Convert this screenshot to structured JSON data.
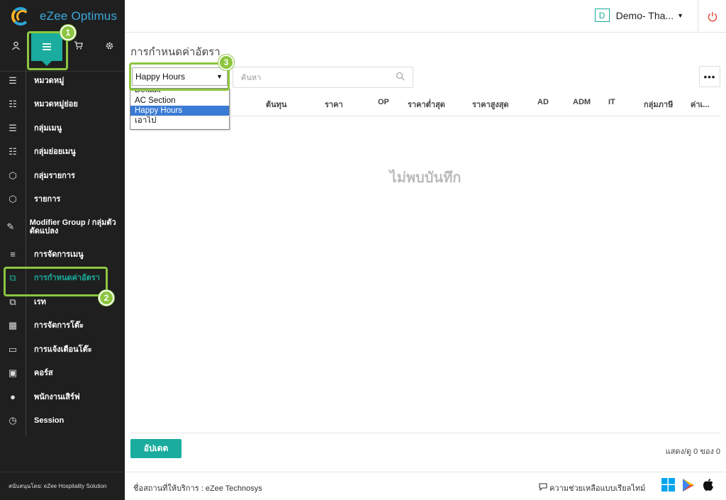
{
  "app": {
    "name": "eZee Optimus"
  },
  "header": {
    "hotel_initial": "D",
    "hotel_name": "Demo- Tha..."
  },
  "sidebar": {
    "items": [
      {
        "label": "หมวดหมู่",
        "icon": "list-icon"
      },
      {
        "label": "หมวดหมู่ย่อย",
        "icon": "sublist-icon"
      },
      {
        "label": "กลุ่มเมนู",
        "icon": "menu-list-icon"
      },
      {
        "label": "กลุ่มย่อยเมนู",
        "icon": "sublist-icon"
      },
      {
        "label": "กลุ่มรายการ",
        "icon": "cube-icon"
      },
      {
        "label": "รายการ",
        "icon": "cube-icon"
      },
      {
        "label": "Modifier Group / กลุ่มตัวดัดแปลง",
        "icon": "edit-icon"
      },
      {
        "label": "การจัดการเมนู",
        "icon": "hamburger-icon"
      },
      {
        "label": "การกำหนดค่าอัตรา",
        "icon": "copy-icon",
        "active": true
      },
      {
        "label": "เรท",
        "icon": "copy-icon"
      },
      {
        "label": "การจัดการโต๊ะ",
        "icon": "grid-icon"
      },
      {
        "label": "การแจ้งเตือนโต๊ะ",
        "icon": "chat-icon"
      },
      {
        "label": "คอร์ส",
        "icon": "book-icon"
      },
      {
        "label": "พนักงานเสิร์ฟ",
        "icon": "user-icon"
      },
      {
        "label": "Session",
        "icon": "clock-icon"
      }
    ],
    "footer": "สนับสนุนโดย: eZee Hospitality Solution"
  },
  "page": {
    "title": "การกำหนดค่าอัตรา",
    "selected_option": "Happy Hours",
    "options": [
      "Default",
      "AC Section",
      "Happy Hours",
      "เอาไป"
    ],
    "search_placeholder": "ค้นหา",
    "more_label": "•••",
    "columns": [
      "ต้นทุน",
      "ราคา",
      "OP",
      "ราคาต่ำสุด",
      "ราคาสูงสุด",
      "AD",
      "ADM",
      "IT",
      "กลุ่มภาษี",
      "ค่าเ..."
    ],
    "empty_text": "ไม่พบบันทึก",
    "update_button": "อัปเดต",
    "count_text": "แสดง/ดู 0 ของ 0"
  },
  "bottom": {
    "provider": "ชื่อสถานที่ให้บริการ : eZee Technosys",
    "helpdesk": "ความช่วยเหลือแบบเรียลไทม์"
  },
  "callouts": [
    "1",
    "2",
    "3"
  ],
  "colors": {
    "accent": "#1aac9e",
    "sidebar_bg": "#1f1f1f",
    "callout": "#8cc63f",
    "power": "#e74c3c"
  }
}
